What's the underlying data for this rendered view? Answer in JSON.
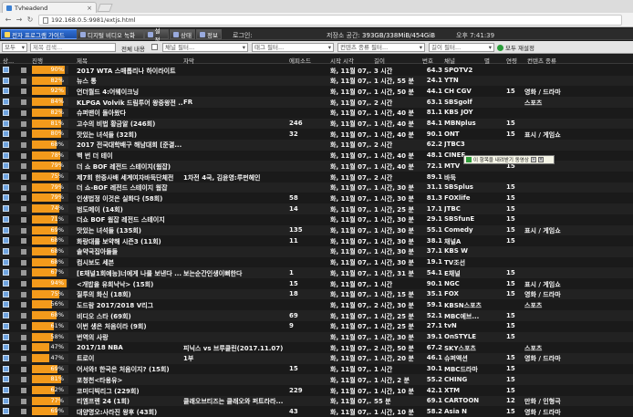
{
  "browser": {
    "tab_title": "Tvheadend",
    "url": "192.168.0.5:9981/extjs.html"
  },
  "toolbar": {
    "tabs": [
      "전자 프로그램 가이드",
      "디지털 비디오 녹화",
      "설정",
      "상태",
      "정보"
    ],
    "login_label": "로그인:",
    "storage_label": "저장소 공간:",
    "storage_value": "393GB/338MiB/454GiB",
    "clock": "오후 7:41:39"
  },
  "filters": {
    "all_option": "모두",
    "title_placeholder": "제목 검색...",
    "fulltext_label": "전체 내용",
    "channel_placeholder": "채널 필터...",
    "tag_placeholder": "태그 필터...",
    "content_type_placeholder": "컨텐츠 종류 필터...",
    "duration_placeholder": "길이 필터...",
    "refresh_label": "모두 재설정"
  },
  "columns": [
    "상...",
    "",
    "진행",
    "제목",
    "자막",
    "에피소드",
    "시작 시각",
    "길이",
    "번호",
    "채널",
    "별",
    "연령",
    "컨텐츠 종류"
  ],
  "rows": [
    {
      "progress": 90,
      "title": "2017 WTA 스매톱리나 하이라이트",
      "subtitle": "",
      "episode": "",
      "start": "화, 11월 07,...",
      "duration": "3 시간",
      "number": "64.3",
      "channel": "SPOTV2",
      "age": "",
      "genre": ""
    },
    {
      "progress": 82,
      "title": "뉴스 통",
      "subtitle": "",
      "episode": "",
      "start": "화, 11월 07,...",
      "duration": "1 시간, 55 분",
      "number": "24.1",
      "channel": "YTN",
      "age": "",
      "genre": ""
    },
    {
      "progress": 92,
      "title": "언더월드 4:어웨이크닝",
      "subtitle": "",
      "episode": "",
      "start": "화, 11월 07,...",
      "duration": "1 시간, 50 분",
      "number": "44.1",
      "channel": "CH CGV",
      "age": "15",
      "genre": "영화 / 드라마"
    },
    {
      "progress": 84,
      "title": "KLPGA Volvik 드림투어 왕중왕전 ...",
      "subtitle": "FR",
      "episode": "",
      "start": "화, 11월 07,...",
      "duration": "2 시간",
      "number": "63.1",
      "channel": "SBSgolf",
      "age": "",
      "genre": "스포츠"
    },
    {
      "progress": 82,
      "title": "슈퍼맨이 돌아왔다",
      "subtitle": "",
      "episode": "",
      "start": "화, 11월 07,...",
      "duration": "1 시간, 40 분",
      "number": "81.1",
      "channel": "KBS JOY",
      "age": "",
      "genre": ""
    },
    {
      "progress": 81,
      "title": "고수의 비법 황금알 (246회)",
      "subtitle": "",
      "episode": "246",
      "start": "화, 11월 07,...",
      "duration": "1 시간, 40 분",
      "number": "84.1",
      "channel": "MBNplus",
      "age": "15",
      "genre": ""
    },
    {
      "progress": 80,
      "title": "맛있는 녀석들 (32회)",
      "subtitle": "",
      "episode": "32",
      "start": "화, 11월 07,...",
      "duration": "1 시간, 40 분",
      "number": "90.1",
      "channel": "ONT",
      "age": "15",
      "genre": "표시 / 게임쇼"
    },
    {
      "progress": 68,
      "title": "2017 전국대학배구 해남대회 [준결...",
      "subtitle": "",
      "episode": "",
      "start": "화, 11월 07,...",
      "duration": "2 시간",
      "number": "62.2",
      "channel": "JTBC3",
      "age": "",
      "genre": ""
    },
    {
      "progress": 78,
      "title": "백 번 더 테이",
      "subtitle": "",
      "episode": "",
      "start": "화, 11월 07,...",
      "duration": "1 시간, 40 분",
      "number": "48.1",
      "channel": "CINEF",
      "age": "",
      "genre": ""
    },
    {
      "progress": 79,
      "title": "더 쇼 BOF 레전드 스테이지(웜잡)",
      "subtitle": "",
      "episode": "",
      "start": "화, 11월 07,...",
      "duration": "1 시간, 40 분",
      "number": "72.1",
      "channel": "MTV",
      "age": "15",
      "genre": ""
    },
    {
      "progress": 75,
      "title": "제7회 한중사배 세계여자바둑단체전",
      "subtitle": "1차전 4국, 김윤영:루펀헤인",
      "episode": "",
      "start": "화, 11월 07,...",
      "duration": "2 시간",
      "number": "89.1",
      "channel": "바둑",
      "age": "",
      "genre": ""
    },
    {
      "progress": 79,
      "title": "더 쇼-BOF 레전드 스테이지 웜잡",
      "subtitle": "",
      "episode": "",
      "start": "화, 11월 07,...",
      "duration": "1 시간, 30 분",
      "number": "31.1",
      "channel": "SBSplus",
      "age": "15",
      "genre": ""
    },
    {
      "progress": 79,
      "title": "인생법정 이것은 실화다 (58회)",
      "subtitle": "",
      "episode": "58",
      "start": "화, 11월 07,...",
      "duration": "1 시간, 30 분",
      "number": "81.3",
      "channel": "FOXlife",
      "age": "15",
      "genre": ""
    },
    {
      "progress": 74,
      "title": "범도메이 (14회)",
      "subtitle": "",
      "episode": "14",
      "start": "화, 11월 07,...",
      "duration": "1 시간, 25 분",
      "number": "17.1",
      "channel": "JTBC",
      "age": "15",
      "genre": ""
    },
    {
      "progress": 71,
      "title": "더쇼 BOF 웜잡 레전드 스테이지",
      "subtitle": "",
      "episode": "",
      "start": "화, 11월 07,...",
      "duration": "1 시간, 30 분",
      "number": "29.1",
      "channel": "SBSfunE",
      "age": "15",
      "genre": ""
    },
    {
      "progress": 69,
      "title": "맛있는 녀석들 (135회)",
      "subtitle": "",
      "episode": "135",
      "start": "화, 11월 07,...",
      "duration": "1 시간, 30 분",
      "number": "55.1",
      "channel": "Comedy",
      "age": "15",
      "genre": "표시 / 게임쇼"
    },
    {
      "progress": 68,
      "title": "화랑대를 보약해 시즌3 (11회)",
      "subtitle": "",
      "episode": "11",
      "start": "화, 11월 07,...",
      "duration": "1 시간, 30 분",
      "number": "38.1",
      "channel": "채널A",
      "age": "15",
      "genre": ""
    },
    {
      "progress": 68,
      "title": "솔약국집아들들",
      "subtitle": "",
      "episode": "",
      "start": "화, 11월 07,...",
      "duration": "1 시간, 30 분",
      "number": "37.1",
      "channel": "KBS W",
      "age": "",
      "genre": ""
    },
    {
      "progress": 68,
      "title": "컴시보도 세븐",
      "subtitle": "",
      "episode": "",
      "start": "화, 11월 07,...",
      "duration": "1 시간, 30 분",
      "number": "19.1",
      "channel": "TV조선",
      "age": "",
      "genre": ""
    },
    {
      "progress": 67,
      "title": "[E채널1회예능]너에게 나를 보낸다 ...",
      "subtitle": "보는순간인생이뻐한다",
      "episode": "1",
      "start": "화, 11월 07,...",
      "duration": "1 시간, 31 분",
      "number": "54.1",
      "channel": "E채널",
      "age": "15",
      "genre": ""
    },
    {
      "progress": 94,
      "title": "<개밥을 유희낙낙> (15회)",
      "subtitle": "",
      "episode": "15",
      "start": "화, 11월 07,...",
      "duration": "1 시간",
      "number": "90.1",
      "channel": "NGC",
      "age": "15",
      "genre": "표시 / 게임쇼"
    },
    {
      "progress": 75,
      "title": "질투의 화신 (18회)",
      "subtitle": "",
      "episode": "18",
      "start": "화, 11월 07,...",
      "duration": "1 시간, 15 분",
      "number": "35.1",
      "channel": "FOX",
      "age": "15",
      "genre": "영화 / 드라마"
    },
    {
      "progress": 56,
      "title": "도드람 2017/2018 V리그",
      "subtitle": "",
      "episode": "",
      "start": "화, 11월 07,...",
      "duration": "2 시간, 30 분",
      "number": "59.1",
      "channel": "KBSN스포츠",
      "age": "",
      "genre": "스포츠"
    },
    {
      "progress": 68,
      "title": "비디오 스타 (69회)",
      "subtitle": "",
      "episode": "69",
      "start": "화, 11월 07,...",
      "duration": "1 시간, 25 분",
      "number": "52.1",
      "channel": "MBC에브...",
      "age": "15",
      "genre": ""
    },
    {
      "progress": 61,
      "title": "이번 생은 처음이라 (9회)",
      "subtitle": "",
      "episode": "9",
      "start": "화, 11월 07,...",
      "duration": "1 시간, 25 분",
      "number": "27.1",
      "channel": "tvN",
      "age": "15",
      "genre": ""
    },
    {
      "progress": 58,
      "title": "번역의 사랑",
      "subtitle": "",
      "episode": "",
      "start": "화, 11월 07,...",
      "duration": "1 시간, 30 분",
      "number": "39.1",
      "channel": "OnSTYLE",
      "age": "15",
      "genre": ""
    },
    {
      "progress": 47,
      "title": "2017/18 NBA",
      "subtitle": "피닉스 vs 브루클린(2017.11.07)",
      "episode": "",
      "start": "화, 11월 07,...",
      "duration": "2 시간, 50 분",
      "number": "67.2",
      "channel": "SKY스포츠",
      "age": "",
      "genre": "스포츠"
    },
    {
      "progress": 47,
      "title": "트로이",
      "subtitle": "1부",
      "episode": "",
      "start": "화, 11월 07,...",
      "duration": "1 시간, 20 분",
      "number": "46.1",
      "channel": "슈퍼액션",
      "age": "15",
      "genre": "영화 / 드라마"
    },
    {
      "progress": 69,
      "title": "어서와! 한국은 처음이지? (15회)",
      "subtitle": "",
      "episode": "15",
      "start": "화, 11월 07,...",
      "duration": "1 시간",
      "number": "30.1",
      "channel": "MBC드라마",
      "age": "15",
      "genre": ""
    },
    {
      "progress": 81,
      "title": "포청천<타용유>",
      "subtitle": "",
      "episode": "",
      "start": "화, 11월 07,...",
      "duration": "1 시간, 2 분",
      "number": "55.2",
      "channel": "CHING",
      "age": "15",
      "genre": ""
    },
    {
      "progress": 62,
      "title": "코미디빅리그 (229회)",
      "subtitle": "",
      "episode": "229",
      "start": "화, 11월 07,...",
      "duration": "1 시간, 10 분",
      "number": "42.1",
      "channel": "XTM",
      "age": "15",
      "genre": ""
    },
    {
      "progress": 77,
      "title": "티엠프렌 24 (1회)",
      "subtitle": "클래오브티즈는 클래오와 퍼트라라...",
      "episode": "",
      "start": "화, 11월 07,...",
      "duration": "55 분",
      "number": "69.1",
      "channel": "CARTOON",
      "age": "12",
      "genre": "만화 / 인형극"
    },
    {
      "progress": 69,
      "title": "대양명오:사라진 왕후 (43회)",
      "subtitle": "",
      "episode": "43",
      "start": "화, 11월 07,...",
      "duration": "1 시간, 10 분",
      "number": "58.2",
      "channel": "Asia N",
      "age": "15",
      "genre": "영화 / 드라마"
    }
  ],
  "popup": {
    "text": "이 항목을 내려받기 동영상"
  },
  "colors": {
    "progress": "#f39a1b",
    "active_tab": "#2f6fd4"
  }
}
